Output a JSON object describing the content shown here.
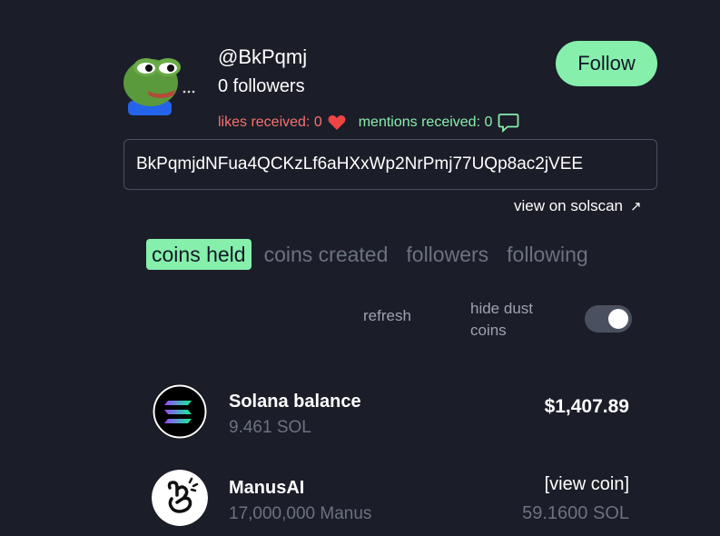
{
  "profile": {
    "username": "@BkPqmj",
    "followers": "0 followers",
    "follow_label": "Follow",
    "likes": "likes received: 0",
    "mentions": "mentions received: 0",
    "address": "BkPqmjdNFua4QCKzLf6aHXxWp2NrPmj77UQp8ac2jVEE",
    "solscan_label": "view on solscan",
    "solscan_arrow": "↗"
  },
  "tabs": [
    {
      "label": "coins held",
      "active": true
    },
    {
      "label": "coins created",
      "active": false
    },
    {
      "label": "followers",
      "active": false
    },
    {
      "label": "following",
      "active": false
    }
  ],
  "controls": {
    "refresh_label": "refresh",
    "hide_dust_label": "hide dust coins",
    "hide_dust_on": true
  },
  "holdings": [
    {
      "name": "Solana balance",
      "amount": "9.461 SOL",
      "value": "$1,407.89",
      "icon": "solana-icon"
    },
    {
      "name": "ManusAI",
      "amount": "17,000,000 Manus",
      "link_label": "[view coin]",
      "sol_value": "59.1600 SOL",
      "icon": "manus-icon"
    }
  ],
  "colors": {
    "background": "#1b1d28",
    "accent_green": "#86efac",
    "likes_red": "#f87171",
    "muted": "#6b7280"
  }
}
